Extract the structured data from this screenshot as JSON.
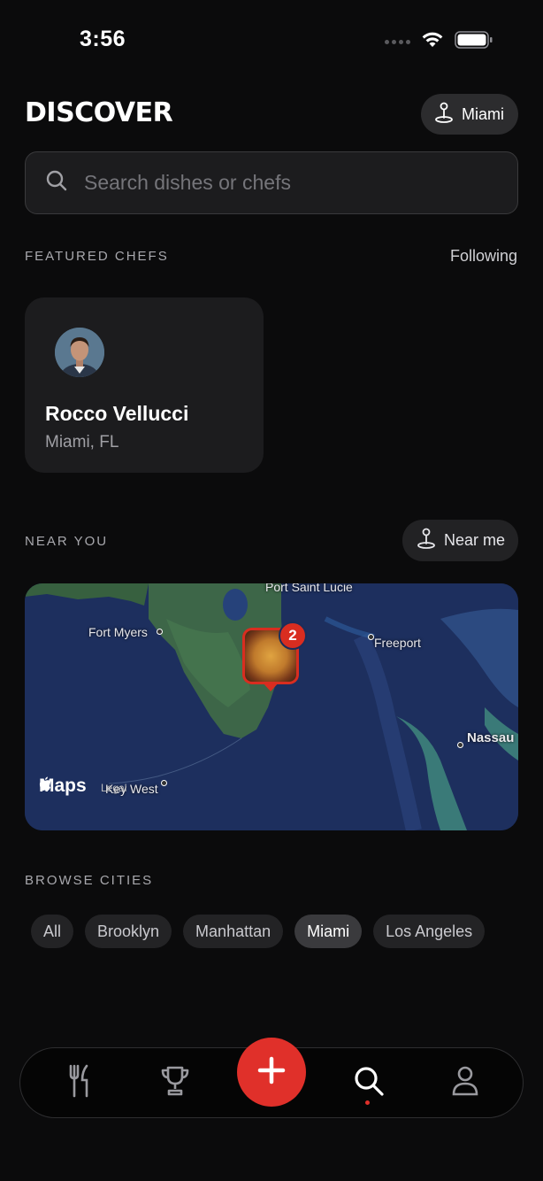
{
  "status": {
    "time": "3:56"
  },
  "header": {
    "title": "DISCOVER",
    "city": "Miami"
  },
  "search": {
    "placeholder": "Search dishes or chefs"
  },
  "featured": {
    "label": "FEATURED CHEFS",
    "following": "Following",
    "chef": {
      "name": "Rocco Vellucci",
      "location": "Miami, FL"
    }
  },
  "near": {
    "label": "NEAR YOU",
    "button": "Near me",
    "map": {
      "labels": [
        "Port Saint Lucie",
        "Fort Myers",
        "Freeport",
        "Nassau",
        "Key West"
      ],
      "legal": "Legal",
      "brand": "Maps",
      "pin_count": "2"
    }
  },
  "cities": {
    "label": "BROWSE CITIES",
    "items": [
      "All",
      "Brooklyn",
      "Manhattan",
      "Miami",
      "Los Angeles"
    ],
    "selected": "Miami"
  },
  "tabs": [
    "fork-knife-icon",
    "trophy-icon",
    "plus-icon",
    "search-icon",
    "person-icon"
  ],
  "colors": {
    "accent": "#e0302a",
    "background": "#0b0b0c",
    "card": "#1c1c1e"
  }
}
